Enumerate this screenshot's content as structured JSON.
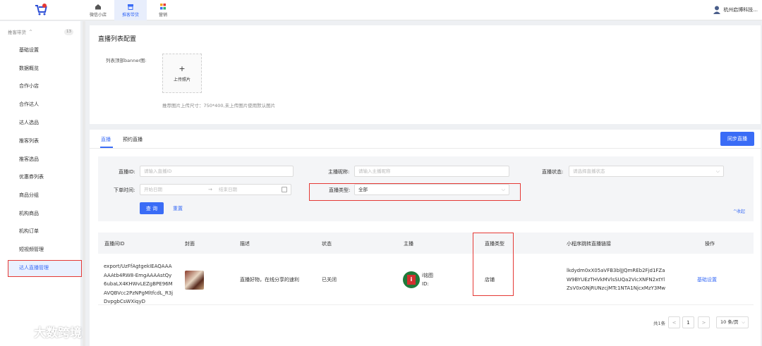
{
  "topnav": [
    {
      "label": "微信小店",
      "icon": "home-icon",
      "active": false
    },
    {
      "label": "推客带货",
      "icon": "store-icon",
      "active": true
    },
    {
      "label": "营销",
      "icon": "apps-icon",
      "active": false
    }
  ],
  "user": {
    "name": "杭州启博科技..."
  },
  "sidebar": {
    "section": "推客带货",
    "section_caret": "^",
    "count": "13",
    "items": [
      "基础设置",
      "数据概览",
      "合作小店",
      "合作达人",
      "达人选品",
      "推客列表",
      "推客选品",
      "优惠券列表",
      "商品分组",
      "机构商品",
      "机构订单",
      "短视频管理",
      "达人直播管理"
    ],
    "active_index": 12
  },
  "config": {
    "title": "直播列表配置",
    "banner_label": "列表顶部banner图:",
    "upload_plus": "+",
    "upload_label": "上传照片",
    "hint": "推荐图片上传尺寸：750*400,未上传图片使用默认图片"
  },
  "tabs": [
    {
      "label": "直播"
    },
    {
      "label": "预约直播"
    }
  ],
  "sync_button": "同步直播",
  "filter": {
    "live_id_label": "直播ID:",
    "live_id_placeholder": "请输入直播ID",
    "anchor_label": "主播昵称:",
    "anchor_placeholder": "请输入主播昵称",
    "status_label": "直播状态:",
    "status_placeholder": "请选择直播状态",
    "order_time_label": "下单时间:",
    "start_placeholder": "开始日期",
    "date_sep": "→",
    "end_placeholder": "结束日期",
    "type_label": "直播类型:",
    "type_value": "全部",
    "query": "查 询",
    "reset": "重置",
    "collapse": "^收起"
  },
  "table": {
    "headers": [
      "直播间ID",
      "封面",
      "描述",
      "状态",
      "主播",
      "直播类型",
      "小程序跳转直播链接",
      "操作"
    ],
    "rows": [
      {
        "id": "export/UzFfAgtgekIEAQAAAAAAtb4RW8-EmgAAAAstQy6ubaLX4KHWvLEZgBPE96MAVQBVcc2PzNPgMltfcdL_R3jDvpgbCsWXiqyD",
        "description": "直播好物，在线分享的速利",
        "status": "已关闭",
        "anchor_name": "i铭图",
        "anchor_id": "ID:",
        "type": "店铺",
        "link": "lkdydm0xX05aVFB3blJJQmREb2Fjd1FZaW9BYUEzTHVkMVlsSUQa2VicXNFN2xtYlZsV0xGNjRUNzcjMTc1NTA1NjcxMzY3Mw",
        "action": "基础设置"
      }
    ]
  },
  "pager": {
    "total": "共1条",
    "prev": "<",
    "page": "1",
    "next": ">",
    "size": "10 条/页"
  },
  "watermark": "大数跨境",
  "colors": {
    "primary": "#3a6cf6",
    "highlight": "#e53935",
    "anchor_icon_bg": "#1e7a3a"
  }
}
